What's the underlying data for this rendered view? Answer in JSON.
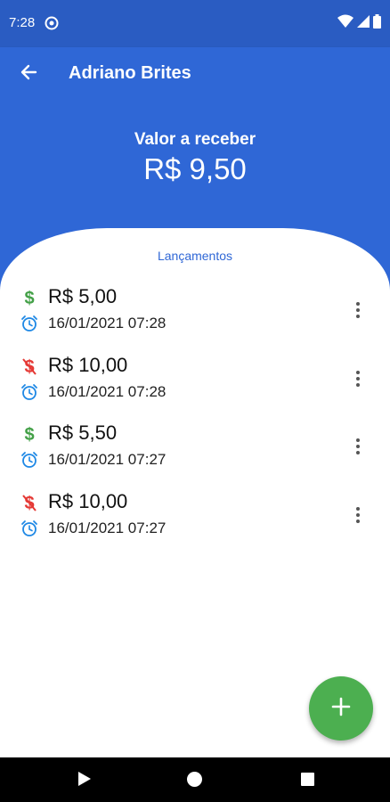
{
  "status_bar": {
    "time": "7:28"
  },
  "app_bar": {
    "title": "Adriano Brites"
  },
  "summary": {
    "label": "Valor a receber",
    "value": "R$ 9,50"
  },
  "list": {
    "title": "Lançamentos",
    "entries": [
      {
        "amount": "R$ 5,00",
        "datetime": "16/01/2021 07:28",
        "type": "income",
        "icon": "dollar-icon"
      },
      {
        "amount": "R$ 10,00",
        "datetime": "16/01/2021 07:28",
        "type": "expense",
        "icon": "money-off-icon"
      },
      {
        "amount": "R$ 5,50",
        "datetime": "16/01/2021 07:27",
        "type": "income",
        "icon": "dollar-icon"
      },
      {
        "amount": "R$ 10,00",
        "datetime": "16/01/2021 07:27",
        "type": "expense",
        "icon": "money-off-icon"
      }
    ]
  },
  "colors": {
    "primary": "#2f67d6",
    "status_bar": "#2a5cc2",
    "income": "#43a047",
    "expense": "#e53935",
    "clock": "#1e88e5",
    "fab": "#4caf50"
  }
}
